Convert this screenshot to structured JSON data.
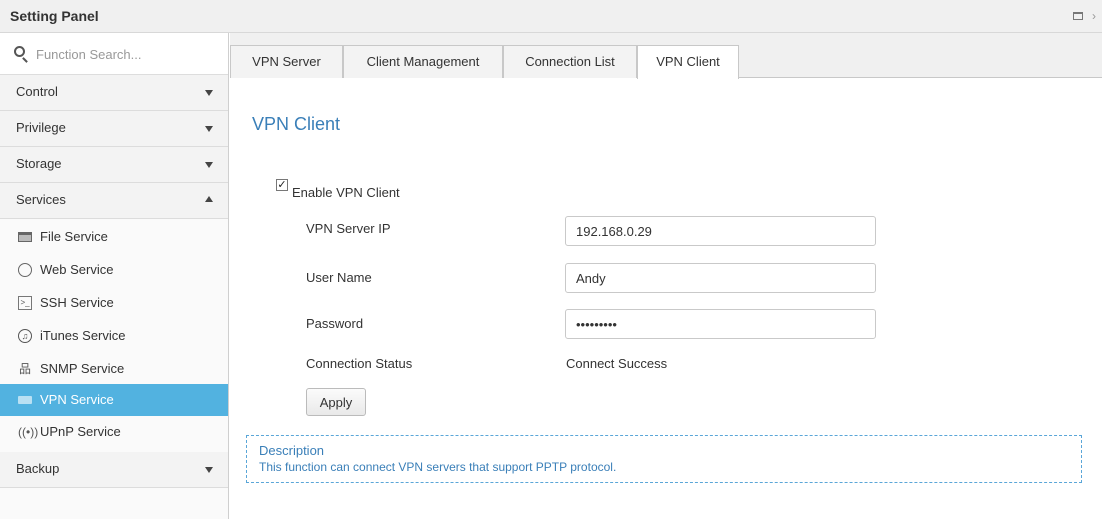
{
  "window": {
    "title": "Setting Panel"
  },
  "sidebar": {
    "search_placeholder": "Function Search...",
    "categories": [
      {
        "label": "Control"
      },
      {
        "label": "Privilege"
      },
      {
        "label": "Storage"
      },
      {
        "label": "Services"
      },
      {
        "label": "Backup"
      }
    ],
    "services": [
      {
        "label": "File Service",
        "icon": "file-service-icon"
      },
      {
        "label": "Web Service",
        "icon": "web-service-icon"
      },
      {
        "label": "SSH Service",
        "icon": "ssh-service-icon"
      },
      {
        "label": "iTunes Service",
        "icon": "itunes-service-icon"
      },
      {
        "label": "SNMP Service",
        "icon": "snmp-service-icon"
      },
      {
        "label": "VPN Service",
        "icon": "vpn-service-icon"
      },
      {
        "label": "UPnP Service",
        "icon": "upnp-service-icon"
      }
    ],
    "active_item": "VPN Service"
  },
  "tabs": [
    {
      "label": "VPN Server"
    },
    {
      "label": "Client Management"
    },
    {
      "label": "Connection List"
    },
    {
      "label": "VPN Client"
    }
  ],
  "active_tab": "VPN Client",
  "content": {
    "title": "VPN Client",
    "enable_label": "Enable VPN Client",
    "enable_checked": true,
    "fields": {
      "server_ip_label": "VPN Server IP",
      "server_ip_value": "192.168.0.29",
      "username_label": "User Name",
      "username_value": "Andy",
      "password_label": "Password",
      "password_value": "•••••••••",
      "status_label": "Connection Status",
      "status_value": "Connect Success"
    },
    "apply_label": "Apply",
    "description_title": "Description",
    "description_text": "This function can connect VPN servers that support PPTP protocol."
  },
  "colors": {
    "accent": "#52b2e0",
    "title_blue": "#3a7fb8"
  }
}
